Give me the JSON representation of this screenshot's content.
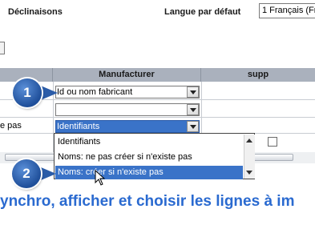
{
  "header": {
    "section_title": "Déclinaisons",
    "language_label": "Langue par défaut",
    "language_value": "1 Français (Fre"
  },
  "grid": {
    "columns": [
      "",
      "Manufacturer",
      "supp"
    ],
    "rows": [
      {
        "left": "",
        "manufacturer": "Id ou nom fabricant"
      },
      {
        "left": "",
        "manufacturer": ""
      },
      {
        "left": "e pas",
        "manufacturer": "Identifiants"
      }
    ]
  },
  "dropdown": {
    "options": [
      "Identifiants",
      "Noms: ne pas créer si n'existe pas",
      "Noms: créer si n'existe pas"
    ],
    "selected_index": 2
  },
  "callouts": [
    "1",
    "2"
  ],
  "banner": "ynchro, afficher et choisir les lignes à im",
  "colors": {
    "accent": "#3a73c8",
    "header_bg": "#aab1bd",
    "banner": "#2a6ad0",
    "badge": "#1f4f9a"
  }
}
